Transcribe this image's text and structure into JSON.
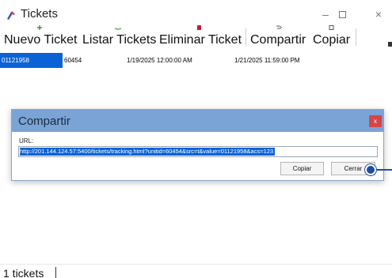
{
  "window": {
    "title": "Tickets",
    "minimize_glyph": "–",
    "close_glyph": "×"
  },
  "toolbar": {
    "new_ticket": "Nuevo Ticket",
    "list_tickets": "Listar Tickets",
    "delete_ticket": "Eliminar Ticket",
    "share": "Compartir",
    "copy": "Copiar"
  },
  "grid": {
    "rows": [
      {
        "ticket_id": "01121958",
        "unit": "60454",
        "start": "1/19/2025 12:00:00 AM",
        "end": "1/21/2025 11:59:00 PM"
      }
    ]
  },
  "dialog": {
    "title": "Compartir",
    "close_glyph": "x",
    "url_label": "URL:",
    "url_value": "http://201.144.124.57:5400/tickets/tracking.html?unitid=60454&src=t&value=01121958&acs=123",
    "copy_label": "Copiar",
    "close_label": "Cerrar"
  },
  "status": {
    "count_text": "1 tickets"
  },
  "icons": {
    "app": "tickets-app-icon",
    "new": "add-icon",
    "list": "list-icon",
    "delete": "delete-icon",
    "share": "share-icon",
    "copy": "copy-icon"
  },
  "colors": {
    "selection": "#0a63d6",
    "dialog_title_bar": "#7aa3d6",
    "dialog_close": "#d64545"
  }
}
